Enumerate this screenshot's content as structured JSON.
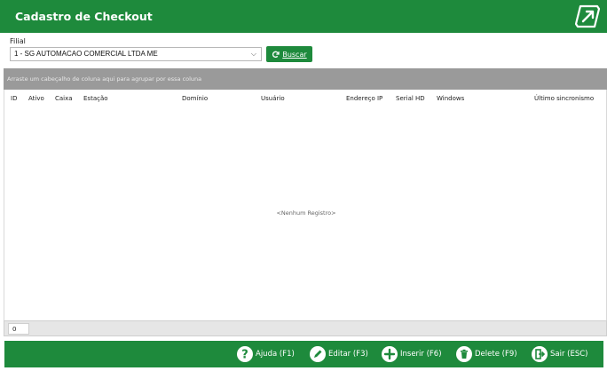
{
  "window": {
    "title": "Cadastro de Checkout"
  },
  "filial": {
    "label": "Filial",
    "selected": "1 - SG AUTOMACAO COMERCIAL LTDA ME",
    "chevron": "⌵"
  },
  "buscar": {
    "label": "Buscar",
    "icon": "refresh-icon"
  },
  "group_hint": "Arraste um cabeçalho de coluna aqui para agrupar por essa coluna",
  "columns": [
    "ID",
    "Ativo",
    "Caixa",
    "Estação",
    "Domínio",
    "Usuário",
    "Endereço IP",
    "Serial HD",
    "Windows",
    "Último sincronismo"
  ],
  "empty_text": "<Nenhum Registro>",
  "record_count": "0",
  "actions": [
    {
      "label": "Ajuda (F1)",
      "icon": "help-icon"
    },
    {
      "label": "Editar (F3)",
      "icon": "pencil-icon"
    },
    {
      "label": "Inserir (F6)",
      "icon": "plus-icon"
    },
    {
      "label": "Delete (F9)",
      "icon": "trash-icon"
    },
    {
      "label": "Sair (ESC)",
      "icon": "exit-icon"
    }
  ],
  "colors": {
    "brand_green": "#1e8a3c",
    "group_bar": "#9a9a9a"
  }
}
